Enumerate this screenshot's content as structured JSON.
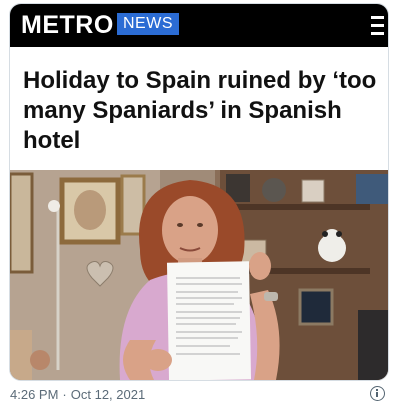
{
  "card": {
    "brand": "METRO",
    "section_badge": "NEWS",
    "menu_icon": "hamburger-menu-icon",
    "headline": "Holiday to Spain ruined by ‘too many Spaniards’ in Spanish hotel",
    "photo": {
      "subject": "woman holding a printed letter in a living room"
    }
  },
  "tweet_meta": {
    "time": "4:26 PM",
    "separator": "·",
    "date": "Oct 12, 2021",
    "info_icon": "info-icon"
  },
  "colors": {
    "masthead_bg": "#000000",
    "badge_bg": "#2b6cd4",
    "headline_text": "#111111",
    "meta_text": "#5b6b78",
    "card_border": "#d6dde3"
  }
}
